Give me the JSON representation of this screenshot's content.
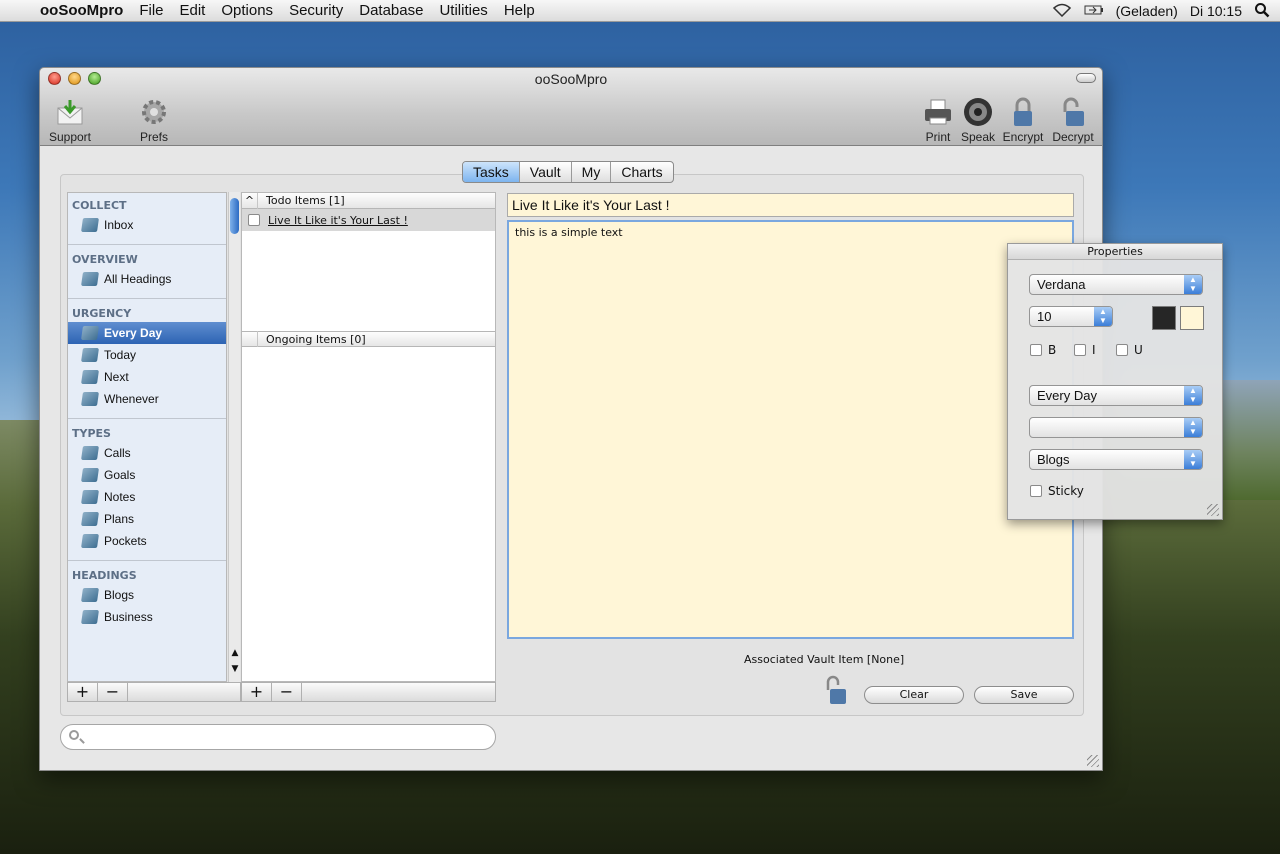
{
  "menubar": {
    "app_name": "ooSooMpro",
    "items": [
      "File",
      "Edit",
      "Options",
      "Security",
      "Database",
      "Utilities",
      "Help"
    ],
    "battery_status": "(Geladen)",
    "clock": "Di 10:15"
  },
  "window": {
    "title": "ooSooMpro",
    "toolbar": {
      "support": "Support",
      "prefs": "Prefs",
      "print": "Print",
      "speak": "Speak",
      "encrypt": "Encrypt",
      "decrypt": "Decrypt"
    }
  },
  "tabs": [
    "Tasks",
    "Vault",
    "My",
    "Charts"
  ],
  "active_tab": "Tasks",
  "sidebar": {
    "sections": [
      {
        "title": "COLLECT",
        "items": [
          "Inbox"
        ]
      },
      {
        "title": "OVERVIEW",
        "items": [
          "All Headings"
        ]
      },
      {
        "title": "URGENCY",
        "items": [
          "Every Day",
          "Today",
          "Next",
          "Whenever"
        ]
      },
      {
        "title": "TYPES",
        "items": [
          "Calls",
          "Goals",
          "Notes",
          "Plans",
          "Pockets"
        ]
      },
      {
        "title": "HEADINGS",
        "items": [
          "Blogs",
          "Business"
        ]
      }
    ],
    "selected": "Every Day",
    "add": "+",
    "remove": "−"
  },
  "list": {
    "todo_header": "Todo Items [1]",
    "todo_caret": "^",
    "todo_items": [
      "Live It Like it's Your Last !"
    ],
    "ongoing_header": "Ongoing Items [0]",
    "add": "+",
    "remove": "−"
  },
  "editor": {
    "title": "Live It Like it's Your Last !",
    "body": "this is a simple text",
    "vault_label": "Associated Vault Item [None]",
    "clear": "Clear",
    "save": "Save"
  },
  "properties": {
    "title": "Properties",
    "font": "Verdana",
    "size": "10",
    "bold": "B",
    "italic": "I",
    "underline": "U",
    "urgency": "Every Day",
    "type": "",
    "heading": "Blogs",
    "sticky": "Sticky",
    "text_color": "#262626",
    "bg_color": "#fff6d7"
  },
  "search": {
    "placeholder": ""
  }
}
